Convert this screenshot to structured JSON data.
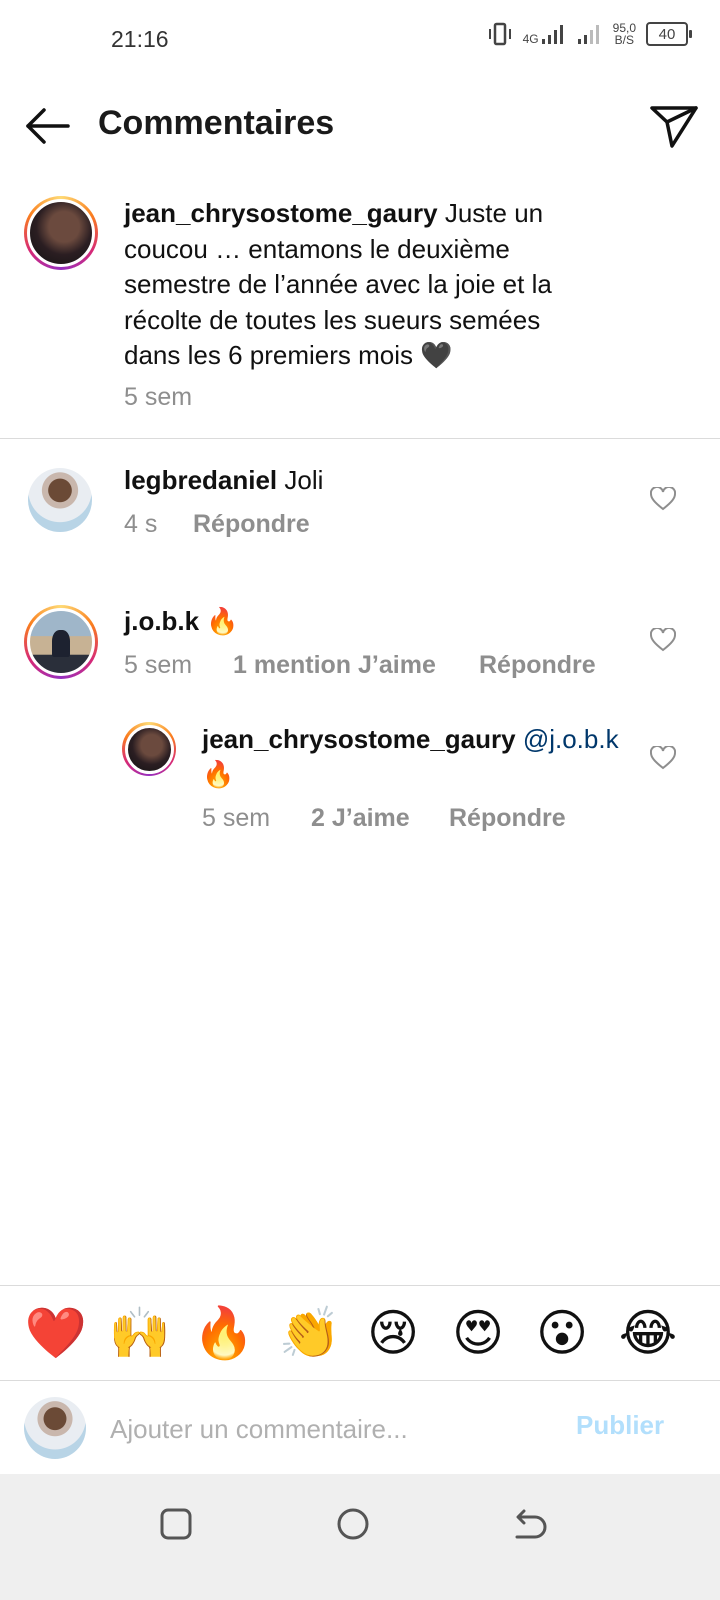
{
  "status_bar": {
    "time": "21:16",
    "network": "4G",
    "speed_value": "95,0",
    "speed_unit": "B/S",
    "battery": "40"
  },
  "header": {
    "title": "Commentaires"
  },
  "caption": {
    "username": "jean_chrysostome_gaury",
    "text": "Juste un coucou … entamons le deuxième semestre de l’année avec la joie et la récolte de toutes les sueurs semées dans les 6 premiers mois 🖤",
    "time": "5 sem"
  },
  "comments": [
    {
      "username": "legbredaniel",
      "text": "Joli",
      "time": "4 s",
      "likes": "",
      "reply_label": "Répondre"
    },
    {
      "username": "j.o.b.k",
      "text": "🔥",
      "time": "5 sem",
      "likes": "1 mention J’aime",
      "reply_label": "Répondre"
    }
  ],
  "reply": {
    "username": "jean_chrysostome_gaury",
    "mention": "@j.o.b.k",
    "text": "🔥",
    "time": "5 sem",
    "likes": "2 J’aime",
    "reply_label": "Répondre"
  },
  "emoji_bar": [
    "❤️",
    "🙌",
    "🔥",
    "👏",
    "😢",
    "😍",
    "😮",
    "😂"
  ],
  "composer": {
    "placeholder": "Ajouter un commentaire...",
    "publish_label": "Publier",
    "publish_color": "#b2dffc"
  },
  "colors": {
    "mention": "#00376b",
    "meta": "#8e8e8e",
    "divider": "#dbdbdb",
    "navbar": "#efefef"
  }
}
